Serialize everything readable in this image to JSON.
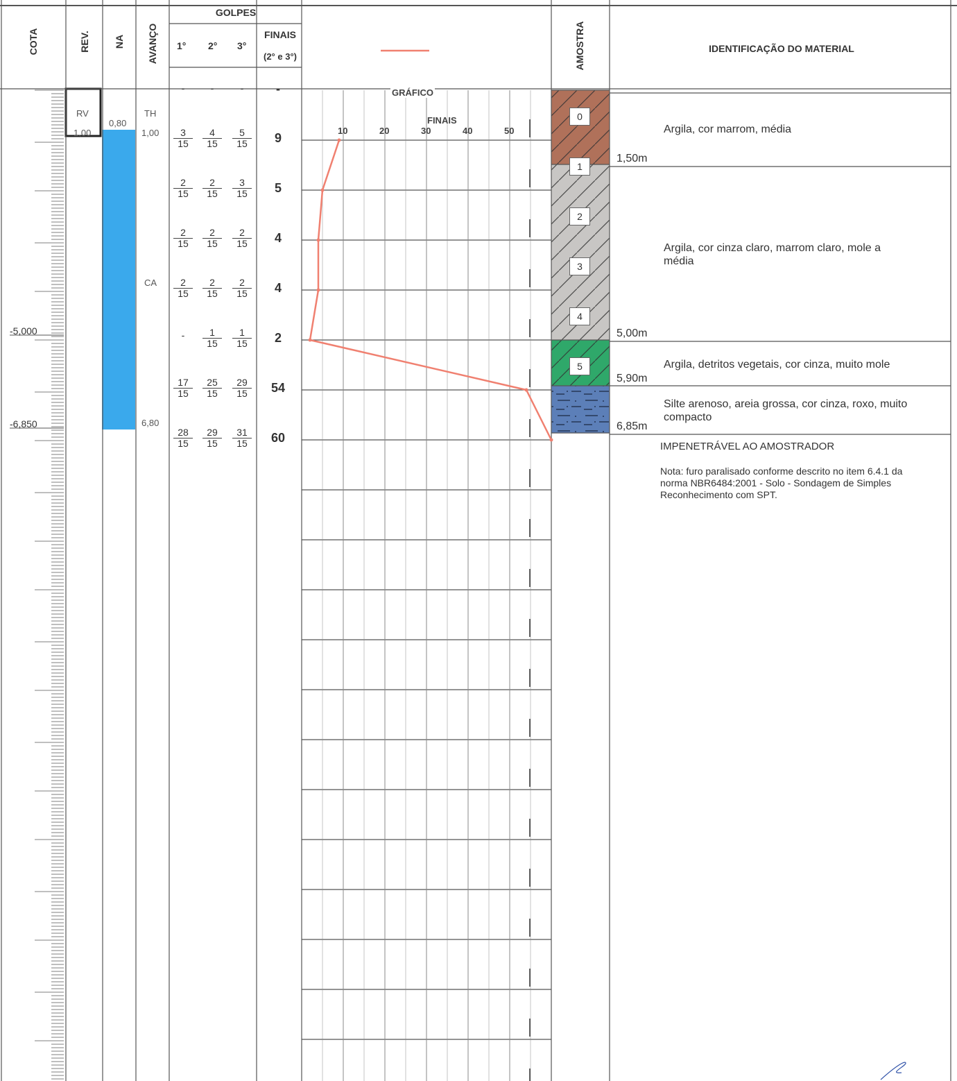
{
  "header": {
    "cota": "COTA",
    "rev": "REV.",
    "na": "NA",
    "avanco": "AVANÇO",
    "golpes": "GOLPES",
    "g1": "1°",
    "g2": "2°",
    "g3": "3°",
    "finais": "FINAIS",
    "finais_sub": "(2° e 3°)",
    "amostra": "AMOSTRA",
    "identificacao": "IDENTIFICAÇÃO DO MATERIAL"
  },
  "cota_marks": [
    "-5,000",
    "-6,850"
  ],
  "rev": {
    "code": "RV",
    "depth": "1,00"
  },
  "na": {
    "start": "0,80",
    "water_color": "#3aa9ec"
  },
  "avanco": {
    "top": "TH",
    "top_depth": "1,00",
    "mid": "CA",
    "bottom_depth": "6,80"
  },
  "golpes_top": {
    "g1": "-",
    "g2": "-",
    "g3": "-",
    "finais": "-"
  },
  "golpes": [
    {
      "g1": [
        "3",
        "15"
      ],
      "g2": [
        "4",
        "15"
      ],
      "g3": [
        "5",
        "15"
      ],
      "finais": "9"
    },
    {
      "g1": [
        "2",
        "15"
      ],
      "g2": [
        "2",
        "15"
      ],
      "g3": [
        "3",
        "15"
      ],
      "finais": "5"
    },
    {
      "g1": [
        "2",
        "15"
      ],
      "g2": [
        "2",
        "15"
      ],
      "g3": [
        "2",
        "15"
      ],
      "finais": "4"
    },
    {
      "g1": [
        "2",
        "15"
      ],
      "g2": [
        "2",
        "15"
      ],
      "g3": [
        "2",
        "15"
      ],
      "finais": "4"
    },
    {
      "g1": [
        "-",
        ""
      ],
      "g2": [
        "1",
        "15"
      ],
      "g3": [
        "1",
        "15"
      ],
      "finais": "2"
    },
    {
      "g1": [
        "17",
        "15"
      ],
      "g2": [
        "25",
        "15"
      ],
      "g3": [
        "29",
        "15"
      ],
      "finais": "54"
    },
    {
      "g1": [
        "28",
        "15"
      ],
      "g2": [
        "29",
        "15"
      ],
      "g3": [
        "31",
        "15"
      ],
      "finais": "60"
    }
  ],
  "grafico": {
    "title": "GRÁFICO",
    "axis_label": "FINAIS",
    "ticks": [
      "10",
      "20",
      "30",
      "40",
      "50"
    ],
    "line_color": "#f08070"
  },
  "chart_data": {
    "type": "line",
    "title": "GRÁFICO",
    "xlabel": "FINAIS",
    "ylabel": "",
    "x_ticks": [
      10,
      20,
      30,
      40,
      50
    ],
    "xlim": [
      0,
      60
    ],
    "series": [
      {
        "values": [
          9,
          5,
          4,
          4,
          2,
          54,
          60
        ]
      }
    ]
  },
  "amostras": [
    "0",
    "1",
    "2",
    "3",
    "4",
    "5"
  ],
  "layer_colors": {
    "brown": "#b0715a",
    "grey": "#c8c6c4",
    "green": "#2fa86a",
    "blue": "#5c7fb8"
  },
  "layers": [
    {
      "depth": "1,50m",
      "desc": "Argila, cor marrom, média"
    },
    {
      "depth": "5,00m",
      "desc": "Argila, cor cinza claro, marrom claro, mole a média"
    },
    {
      "depth": "5,90m",
      "desc": "Argila, detritos vegetais, cor cinza, muito mole"
    },
    {
      "depth": "6,85m",
      "desc": "Silte arenoso, areia grossa, cor cinza, roxo, muito compacto"
    }
  ],
  "end_text": "IMPENETRÁVEL AO AMOSTRADOR",
  "note": "Nota: furo paralisado conforme descrito no item 6.4.1 da norma NBR6484:2001 - Solo - Sondagem de Simples Reconhecimento com SPT."
}
